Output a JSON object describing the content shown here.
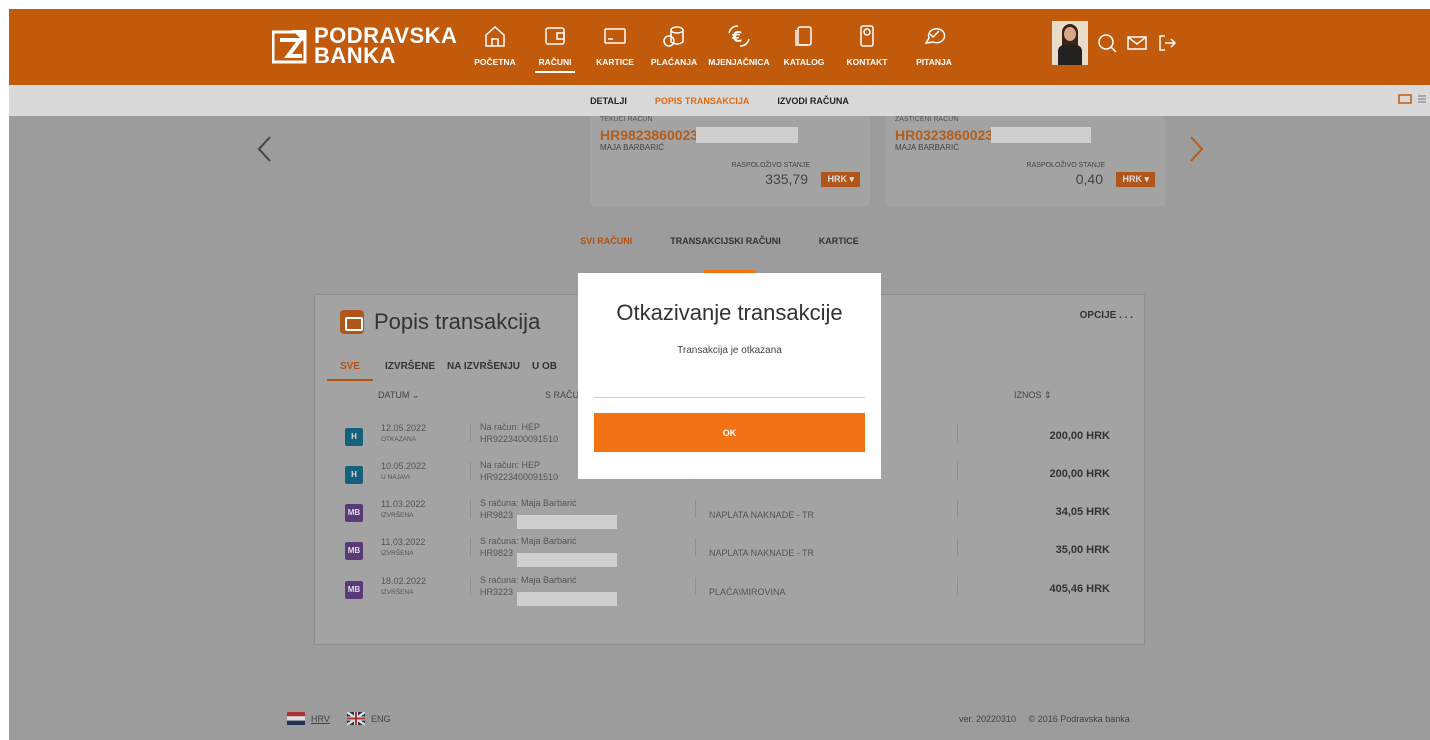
{
  "brand": {
    "line1": "PODRAVSKA",
    "line2": "BANKA"
  },
  "nav": [
    {
      "label": "POČETNA",
      "icon": "home-icon"
    },
    {
      "label": "RAČUNI",
      "icon": "wallet-icon"
    },
    {
      "label": "KARTICE",
      "icon": "card-icon"
    },
    {
      "label": "PLAĆANJA",
      "icon": "coins-icon"
    },
    {
      "label": "MJENJAČNICA",
      "icon": "exchange-icon"
    },
    {
      "label": "KATALOG",
      "icon": "catalog-icon"
    },
    {
      "label": "KONTAKT",
      "icon": "contact-icon"
    },
    {
      "label": "PITANJA",
      "icon": "questions-icon"
    }
  ],
  "subnav": [
    "DETALJI",
    "POPIS TRANSAKCIJA",
    "IZVODI RAČUNA"
  ],
  "accounts": [
    {
      "type": "TEKUĆI RAČUN",
      "iban": "HR9823860023",
      "owner": "MAJA BARBARIĆ",
      "balance_label": "RASPOLOŽIVO STANJE",
      "balance": "335,79",
      "currency": "HRK ▾"
    },
    {
      "type": "ZAŠTIĆENI RAČUN",
      "iban": "HR0323860023",
      "owner": "MAJA BARBARIĆ",
      "balance_label": "RASPOLOŽIVO STANJE",
      "balance": "0,40",
      "currency": "HRK ▾"
    }
  ],
  "account_tabs": [
    "SVI RAČUNI",
    "TRANSAKCIJSKI RAČUNI",
    "KARTICE"
  ],
  "panel": {
    "title": "Popis transakcija",
    "options": "OPCIJE . . .",
    "filters": [
      "SVE",
      "IZVRŠENE",
      "NA IZVRŠENJU",
      "U OB"
    ],
    "headers": {
      "date": "DATUM  ⌄",
      "account": "S RAČUNA /",
      "amount": "IZNOS  ⇕"
    }
  },
  "transactions": [
    {
      "badge": "H",
      "date": "12.05.2022",
      "status": "OTKAZANA",
      "desc1": "Na račun: HEP",
      "desc2": "HR9223400091510",
      "purpose": "",
      "amount": "200,00 HRK",
      "color": "#15607a",
      "sign": "-"
    },
    {
      "badge": "H",
      "date": "10.05.2022",
      "status": "U NAJAVI",
      "desc1": "Na račun: HEP",
      "desc2": "HR9223400091510",
      "purpose": "",
      "amount": "200,00 HRK",
      "color": "#15607a",
      "sign": "-"
    },
    {
      "badge": "MB",
      "date": "11.03.2022",
      "status": "IZVRŠENA",
      "desc1": "S računa: Maja Barbarić",
      "desc2": "HR9823",
      "purpose": "NAPLATA NAKNADE - TR",
      "amount": "34,05 HRK",
      "color": "#5a3a78",
      "sign": "-"
    },
    {
      "badge": "MB",
      "date": "11.03.2022",
      "status": "IZVRŠENA",
      "desc1": "S računa: Maja Barbarić",
      "desc2": "HR9823",
      "purpose": "NAPLATA NAKNADE - TR",
      "amount": "35,00 HRK",
      "color": "#5a3a78",
      "sign": "-"
    },
    {
      "badge": "MB",
      "date": "18.02.2022",
      "status": "IZVRŠENA",
      "desc1": "S računa: Maja Barbarić",
      "desc2": "HR3223",
      "purpose": "PLAĆA\\MIROVINA",
      "amount": "405,46 HRK",
      "color": "#5a3a78",
      "sign": "+"
    }
  ],
  "footer": {
    "lang_hr": "HRV",
    "lang_en": "ENG",
    "version": "ver. 20220310",
    "copyright": "© 2016 Podravska banka"
  },
  "modal": {
    "title": "Otkazivanje transakcije",
    "message": "Transakcija je otkazana",
    "ok": "OK"
  },
  "colors": {
    "brand": "#c25a0c",
    "accent": "#f47216"
  }
}
